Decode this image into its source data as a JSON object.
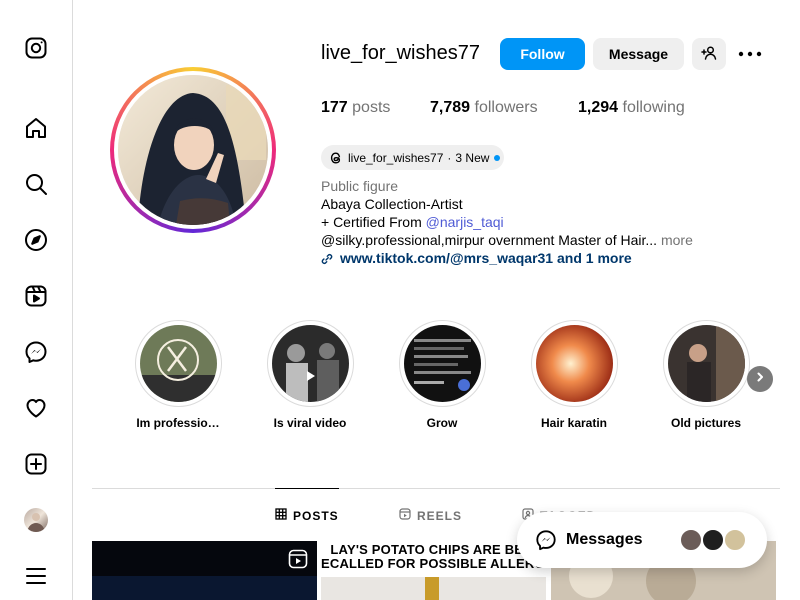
{
  "sidebar": {
    "items": [
      {
        "name": "instagram-logo",
        "icon": "instagram-icon"
      },
      {
        "name": "home",
        "icon": "home-icon"
      },
      {
        "name": "search",
        "icon": "search-icon"
      },
      {
        "name": "explore",
        "icon": "compass-icon"
      },
      {
        "name": "reels",
        "icon": "reels-icon"
      },
      {
        "name": "messages",
        "icon": "messenger-icon"
      },
      {
        "name": "notifications",
        "icon": "heart-icon"
      },
      {
        "name": "create",
        "icon": "plus-square-icon"
      },
      {
        "name": "profile",
        "icon": "avatar"
      },
      {
        "name": "more",
        "icon": "menu-icon"
      }
    ]
  },
  "profile": {
    "username": "live_for_wishes77",
    "follow_label": "Follow",
    "message_label": "Message",
    "stats": {
      "posts_count": "177",
      "posts_label": "posts",
      "followers_count": "7,789",
      "followers_label": "followers",
      "following_count": "1,294",
      "following_label": "following"
    },
    "threads": {
      "handle": "live_for_wishes77",
      "separator": "·",
      "new_label": "3 New"
    },
    "category": "Public figure",
    "bio_line1": "Abaya Collection-Artist",
    "bio_line2_prefix": "+ Certified From ",
    "bio_line2_mention": "@narjis_taqi",
    "bio_line3": "@silky.professional,mirpur overnment Master of Hair...",
    "bio_more": "more",
    "external_link": "www.tiktok.com/@mrs_waqar31 and 1 more"
  },
  "highlights": [
    {
      "label": "Im professio…"
    },
    {
      "label": "Is viral video"
    },
    {
      "label": "Grow"
    },
    {
      "label": "Hair karatin"
    },
    {
      "label": "Old pictures"
    }
  ],
  "tabs": [
    {
      "label": "POSTS",
      "icon": "grid-icon",
      "active": true
    },
    {
      "label": "REELS",
      "icon": "reels-icon",
      "active": false
    },
    {
      "label": "TAGGED",
      "icon": "tag-icon",
      "active": false
    }
  ],
  "posts": [
    {
      "caption": ""
    },
    {
      "caption": "LAY'S POTATO CHIPS ARE BEIN\nECALLED FOR POSSIBLE ALLERGI"
    },
    {
      "caption": ""
    }
  ],
  "messages_pill": {
    "label": "Messages"
  },
  "colors": {
    "accent": "#0095f6",
    "link": "#00376b",
    "mention": "#4f5bd5",
    "secondary_text": "#737373"
  }
}
